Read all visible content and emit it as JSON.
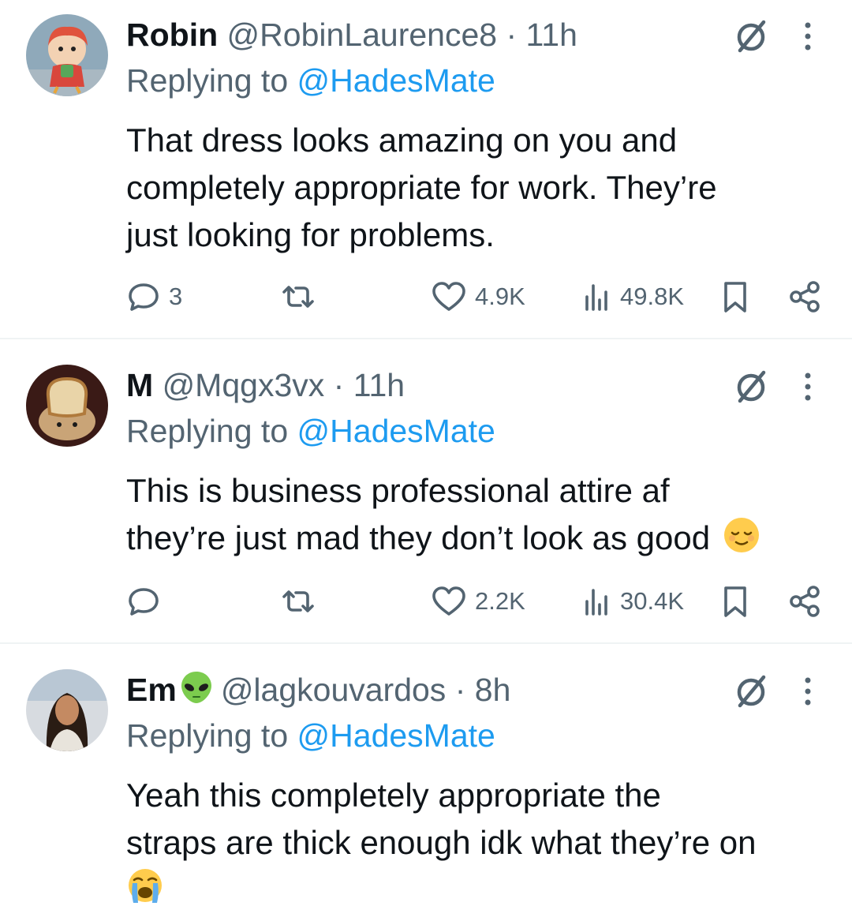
{
  "colors": {
    "text": "#0f1419",
    "secondary": "#536471",
    "link": "#1d9bf0",
    "divider": "#eff3f4"
  },
  "tweets": [
    {
      "name": "Robin",
      "handle": "@RobinLaurence8",
      "separator": "·",
      "time": "11h",
      "replying_prefix": "Replying to",
      "replying_to": "@HadesMate",
      "lines": [
        "That dress looks amazing on you and",
        "completely appropriate for work. They’re",
        "just looking for problems."
      ],
      "replies": "3",
      "retweets": "",
      "likes": "4.9K",
      "views": "49.8K",
      "avatar_icon": "cartoon-avatar"
    },
    {
      "name": "M",
      "handle": "@Mqgx3vx",
      "separator": "·",
      "time": "11h",
      "replying_prefix": "Replying to",
      "replying_to": "@HadesMate",
      "lines": [
        "This is business professional attire af",
        "they’re just mad they don’t look as good"
      ],
      "trailing_emoji": "relieved-face-emoji",
      "replies": "",
      "retweets": "",
      "likes": "2.2K",
      "views": "30.4K",
      "avatar_icon": "bread-dog-avatar"
    },
    {
      "name": "Em",
      "name_emoji": "alien-emoji",
      "handle": "@lagkouvardos",
      "separator": "·",
      "time": "8h",
      "replying_prefix": "Replying to",
      "replying_to": "@HadesMate",
      "lines": [
        "Yeah this completely appropriate the",
        "straps are thick enough idk what they’re on"
      ],
      "trailing_emoji": "loudly-crying-face-emoji",
      "avatar_icon": "photo-avatar"
    }
  ]
}
